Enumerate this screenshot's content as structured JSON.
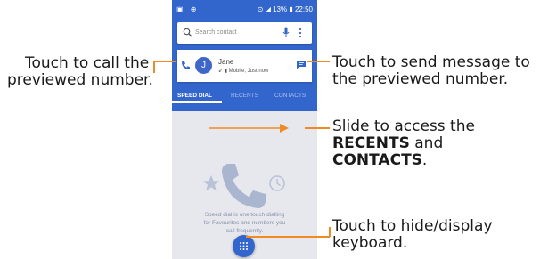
{
  "status_bar": {
    "time": "22:50",
    "battery": "13%"
  },
  "search": {
    "placeholder": "Search contact"
  },
  "preview": {
    "initial": "J",
    "name": "Jane",
    "meta": "Mobile, Just now"
  },
  "tabs": [
    "SPEED DIAL",
    "RECENTS",
    "CONTACTS"
  ],
  "speed_dial_text": [
    "Speed dial is one touch dialling",
    "for Favourites and numbers you",
    "call frequently."
  ],
  "annotations": {
    "call": [
      "Touch to call the",
      "previewed number."
    ],
    "message": [
      "Touch to send message to",
      "the previewed number."
    ],
    "slide_1": "Slide to access the",
    "slide_recents": "RECENTS",
    "slide_and": " and",
    "slide_contacts": "CONTACTS",
    "slide_period": ".",
    "keyboard": [
      "Touch to hide/display",
      "keyboard."
    ]
  },
  "colors": {
    "accent": "#3366cc",
    "annotation_line": "#f08a24"
  }
}
